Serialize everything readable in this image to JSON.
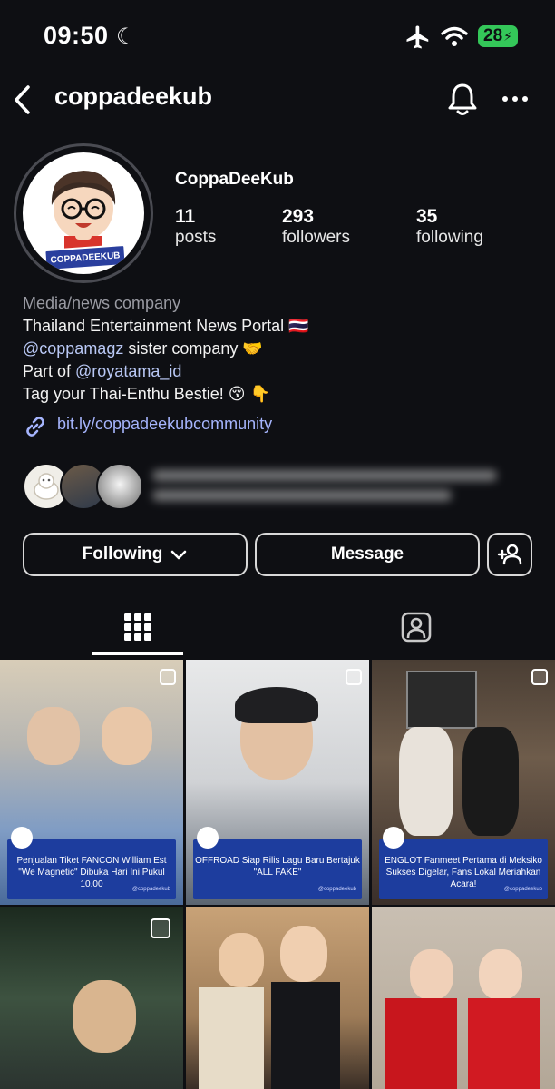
{
  "status_bar": {
    "time": "09:50",
    "battery": "28"
  },
  "header": {
    "username": "coppadeekub"
  },
  "profile": {
    "display_name": "CoppaDeeKub",
    "avatar_badge": "COPPADEEKUB",
    "stats": [
      {
        "value": "11",
        "label": "posts"
      },
      {
        "value": "293",
        "label": "followers"
      },
      {
        "value": "35",
        "label": "following"
      }
    ],
    "category": "Media/news company",
    "bio": {
      "line1": "Thailand Entertainment News Portal 🇹🇭",
      "line2_mention": "@coppamagz",
      "line2_rest": " sister company 🤝",
      "line3_prefix": "Part of ",
      "line3_mention": "@royatama_id",
      "line4": "Tag your Thai-Enthu Bestie! 😚 👇"
    },
    "link": "bit.ly/coppadeekubcommunity"
  },
  "buttons": {
    "following": "Following",
    "message": "Message"
  },
  "icons": [
    "back-arrow-icon",
    "bell-icon",
    "more-icon",
    "link-icon",
    "chevron-down-icon",
    "add-person-icon",
    "grid-icon",
    "tagged-icon",
    "multi-post-icon",
    "airplane-icon",
    "wifi-icon",
    "moon-icon"
  ],
  "posts": [
    {
      "caption": "Penjualan Tiket FANCON William Est \"We Magnetic\" Dibuka Hari Ini Pukul 10.00",
      "handle": "@coppadeekub",
      "bg": "#9aa7b3"
    },
    {
      "caption": "OFFROAD Siap Rilis Lagu Baru Bertajuk \"ALL FAKE\"",
      "handle": "@coppadeekub",
      "bg": "#c9ccd0"
    },
    {
      "caption": "ENGLOT Fanmeet Pertama di Meksiko Sukses Digelar, Fans Lokal Meriahkan Acara!",
      "handle": "@coppadeekub",
      "bg": "#6a5a4c"
    },
    {
      "caption": "",
      "handle": "",
      "bg": "#2d3a2a"
    },
    {
      "caption": "",
      "handle": "",
      "bg": "#b48e62"
    },
    {
      "caption": "",
      "handle": "",
      "bg": "#b8ad9f"
    }
  ],
  "colors": {
    "background": "#0e0f13",
    "link": "#a5b4fc",
    "caption_blue": "#1d3d9e",
    "battery": "#34c759"
  }
}
